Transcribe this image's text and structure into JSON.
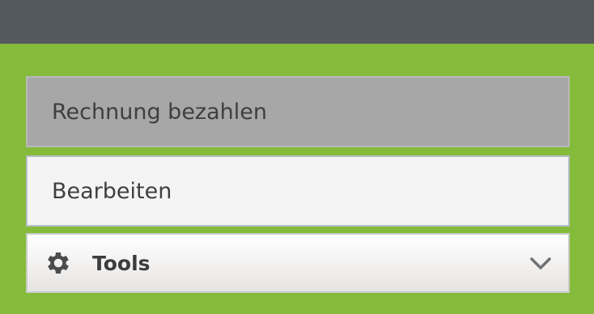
{
  "actions": {
    "pay_bill_label": "Rechnung bezahlen",
    "edit_label": "Bearbeiten",
    "tools_label": "Tools"
  },
  "icons": {
    "tools": "gear-icon",
    "tools_expand": "chevron-down-icon"
  },
  "colors": {
    "header_bar": "#54595e",
    "background": "#84bb3a",
    "pay_button": "#a7a7a7",
    "edit_button": "#f4f4f4",
    "text": "#3d3f41"
  }
}
